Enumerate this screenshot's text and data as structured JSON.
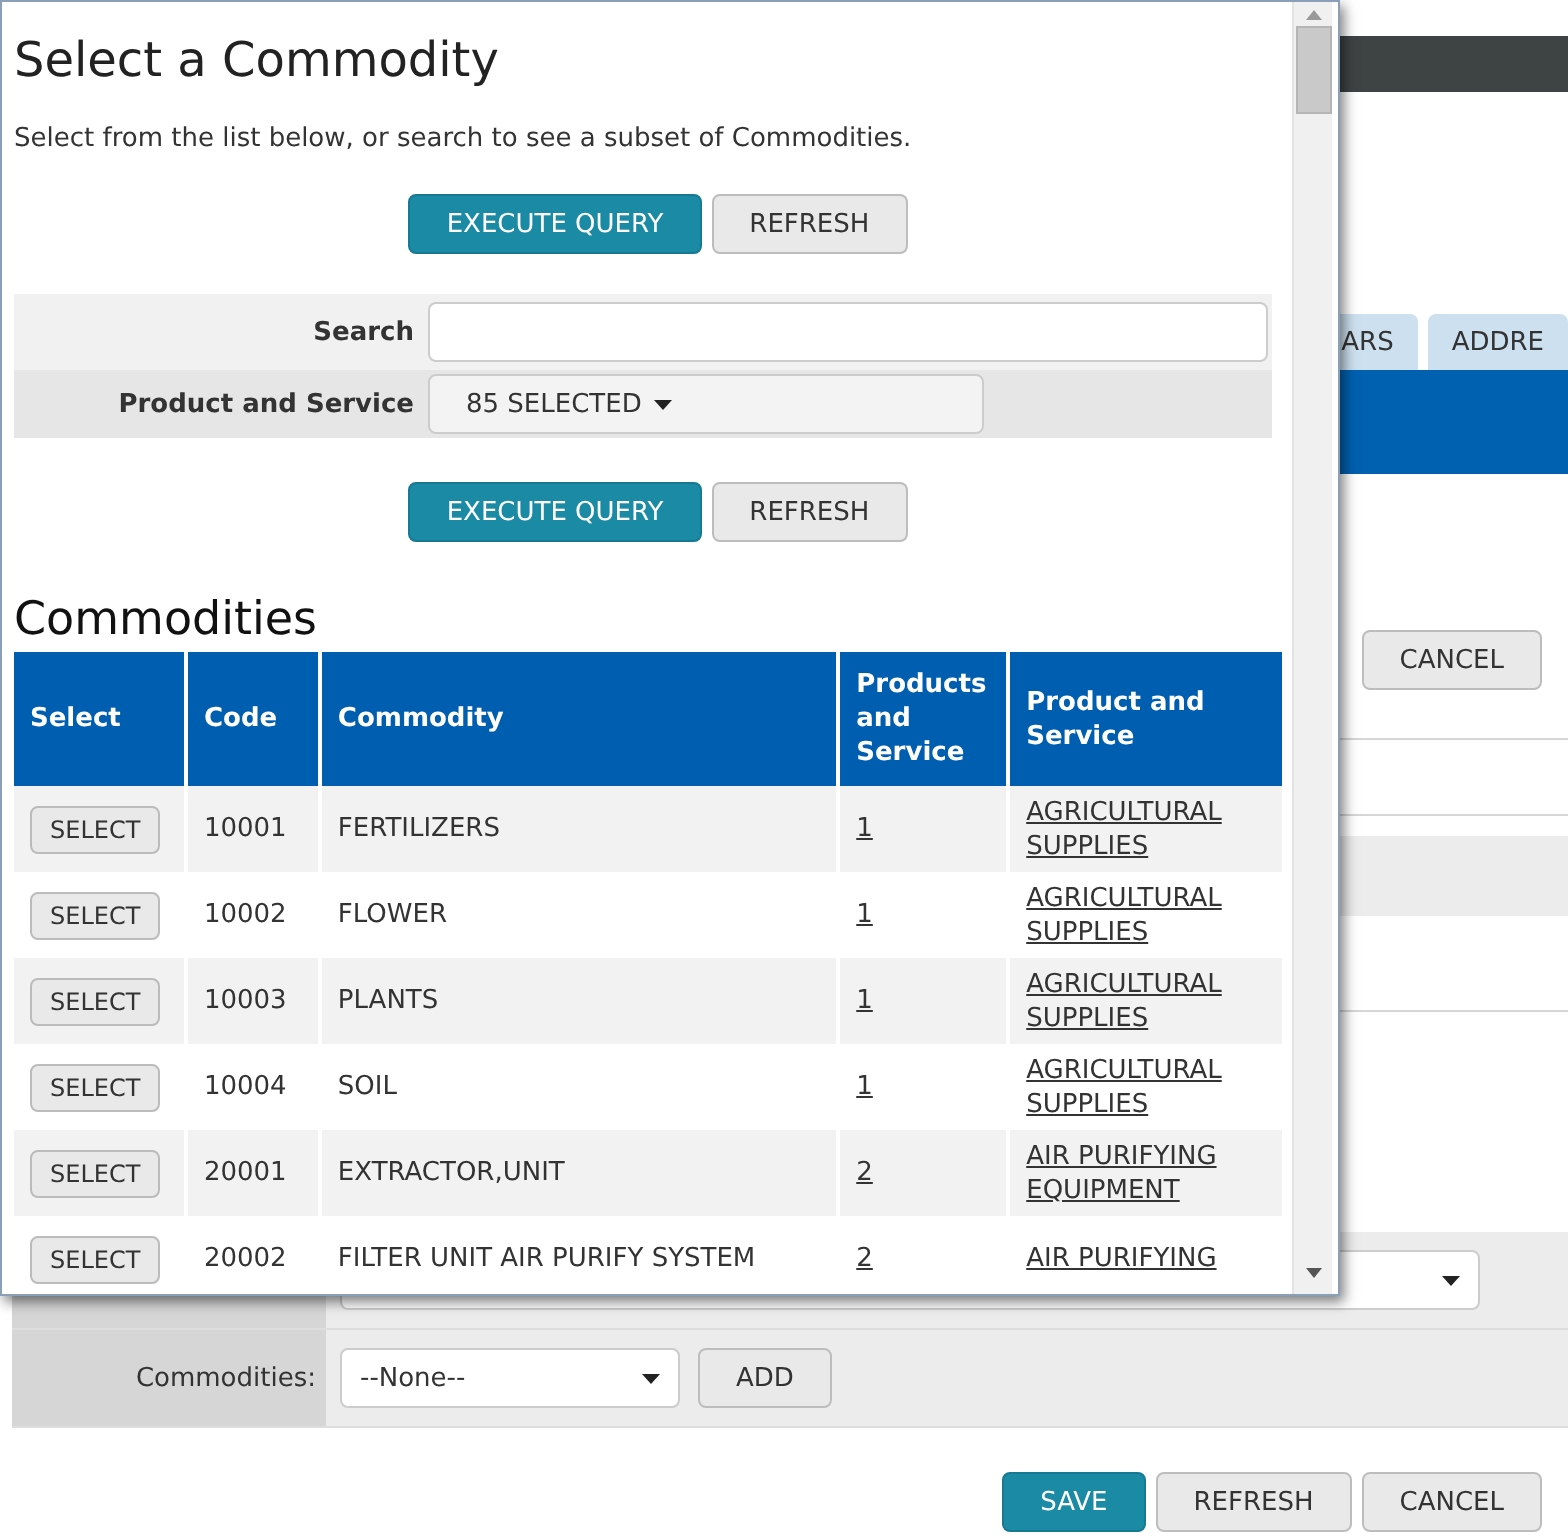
{
  "background": {
    "tabs": [
      {
        "label": "ARS"
      },
      {
        "label": "ADDRE"
      }
    ],
    "cancel_button": "CANCEL",
    "commodities_label": "Commodities:",
    "commodities_select": "--None--",
    "add_button": "ADD",
    "footer_buttons": [
      {
        "label": "SAVE",
        "kind": "primary"
      },
      {
        "label": "REFRESH",
        "kind": "default"
      },
      {
        "label": "CANCEL",
        "kind": "default"
      }
    ]
  },
  "dialog": {
    "title": "Select a Commodity",
    "instructions": "Select from the list below, or search to see a subset of Commodities.",
    "query_buttons_top": [
      {
        "label": "EXECUTE QUERY",
        "kind": "primary"
      },
      {
        "label": "REFRESH",
        "kind": "default"
      }
    ],
    "search": {
      "label": "Search"
    },
    "filter": {
      "label": "Product and Service",
      "value": "85 SELECTED"
    },
    "query_buttons_bottom": [
      {
        "label": "EXECUTE QUERY",
        "kind": "primary"
      },
      {
        "label": "REFRESH",
        "kind": "default"
      }
    ],
    "section_title": "Commodities",
    "table": {
      "columns": [
        "Select",
        "Code",
        "Commodity",
        "Products and Service",
        "Product and Service"
      ],
      "rows": [
        {
          "action": "SELECT",
          "code": "10001",
          "commodity": "FERTILIZERS",
          "count": "1",
          "product_service": "AGRICULTURAL SUPPLIES"
        },
        {
          "action": "SELECT",
          "code": "10002",
          "commodity": "FLOWER",
          "count": "1",
          "product_service": "AGRICULTURAL SUPPLIES"
        },
        {
          "action": "SELECT",
          "code": "10003",
          "commodity": "PLANTS",
          "count": "1",
          "product_service": "AGRICULTURAL SUPPLIES"
        },
        {
          "action": "SELECT",
          "code": "10004",
          "commodity": "SOIL",
          "count": "1",
          "product_service": "AGRICULTURAL SUPPLIES"
        },
        {
          "action": "SELECT",
          "code": "20001",
          "commodity": "EXTRACTOR,UNIT",
          "count": "2",
          "product_service": "AIR PURIFYING EQUIPMENT"
        },
        {
          "action": "SELECT",
          "code": "20002",
          "commodity": "FILTER UNIT AIR PURIFY SYSTEM",
          "count": "2",
          "product_service": "AIR PURIFYING"
        }
      ]
    }
  }
}
